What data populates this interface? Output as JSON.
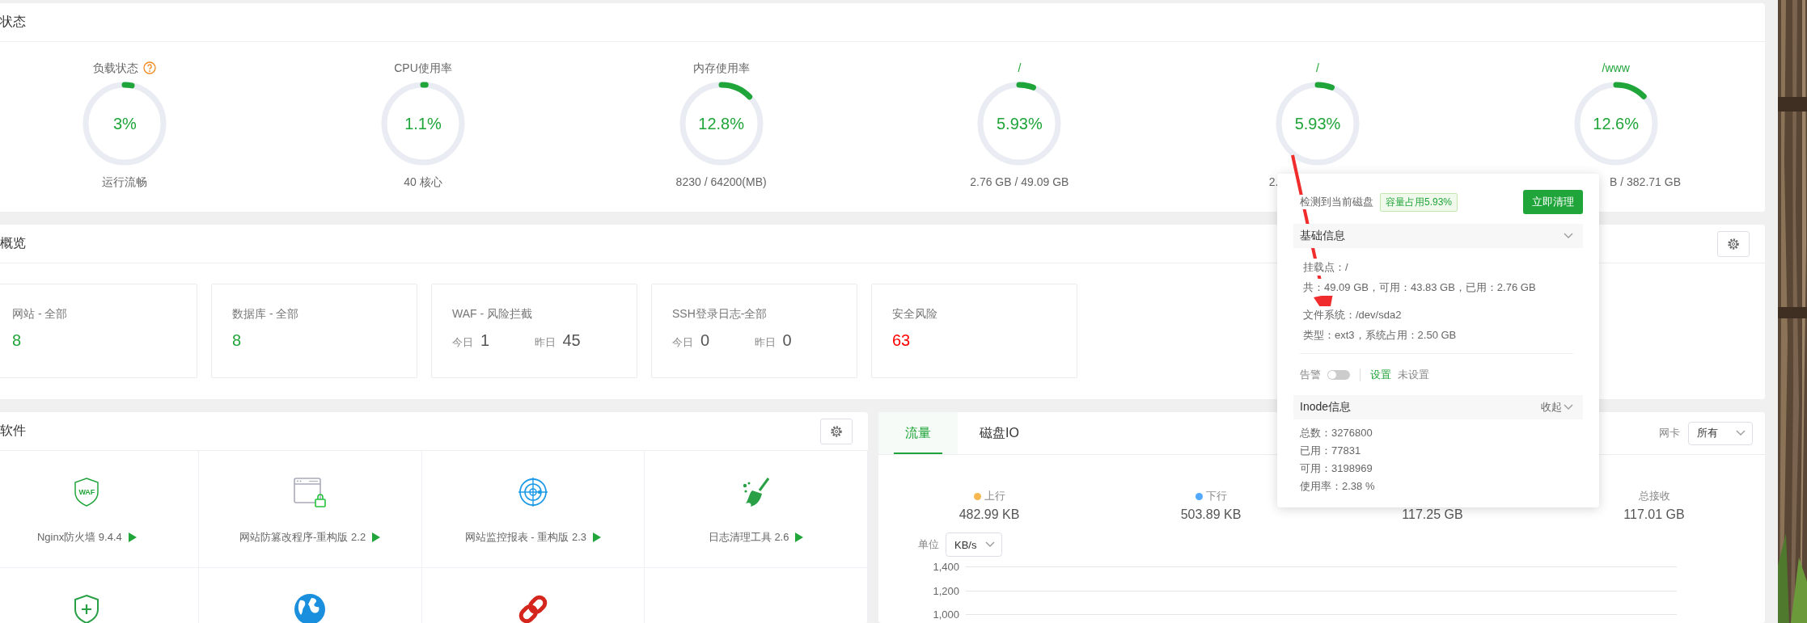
{
  "status_panel": {
    "title": "状态",
    "gauges": [
      {
        "kind": "load",
        "label": "负载状态",
        "value": "3%",
        "level": 0.03,
        "caption": "运行流畅"
      },
      {
        "kind": "cpu",
        "label": "CPU使用率",
        "value": "1.1%",
        "level": 0.011,
        "caption": "40 核心"
      },
      {
        "kind": "memory",
        "label": "内存使用率",
        "value": "12.8%",
        "level": 0.128,
        "caption": "8230 / 64200(MB)"
      },
      {
        "kind": "disk",
        "label": "/",
        "value": "5.93%",
        "level": 0.0593,
        "caption": "2.76 GB / 49.09 GB"
      },
      {
        "kind": "disk",
        "label": "/",
        "value": "5.93%",
        "level": 0.0593,
        "caption": "2."
      },
      {
        "kind": "disk",
        "label": "/www",
        "value": "12.6%",
        "level": 0.126,
        "caption": "B / 382.71 GB"
      }
    ]
  },
  "overview": {
    "title": "概览",
    "cards": [
      {
        "kind": "count",
        "label": "网站 - 全部",
        "value": "8",
        "color": "#20a53a"
      },
      {
        "kind": "count",
        "label": "数据库 - 全部",
        "value": "8",
        "color": "#20a53a"
      },
      {
        "kind": "pair",
        "label": "WAF - 风险拦截",
        "today_label": "今日",
        "today": "1",
        "yesterday_label": "昨日",
        "yesterday": "45"
      },
      {
        "kind": "pair",
        "label": "SSH登录日志-全部",
        "today_label": "今日",
        "today": "0",
        "yesterday_label": "昨日",
        "yesterday": "0"
      },
      {
        "kind": "count",
        "label": "安全风险",
        "value": "63",
        "color": "#ff0000"
      }
    ]
  },
  "software": {
    "title": "软件",
    "items": [
      {
        "kind": "waf",
        "icon_text": "WAF",
        "name": "Nginx防火墙 9.4.4"
      },
      {
        "kind": "tamper",
        "name": "网站防篡改程序-重构版 2.2"
      },
      {
        "kind": "radar",
        "name": "网站监控报表 - 重构版 2.3"
      },
      {
        "kind": "broom",
        "name": "日志清理工具 2.6"
      },
      {
        "kind": "shield"
      },
      {
        "kind": "globe"
      },
      {
        "kind": "link"
      }
    ]
  },
  "traffic": {
    "tabs": [
      {
        "label": "流量",
        "selected": true
      },
      {
        "label": "磁盘IO",
        "selected": false
      }
    ],
    "nic_label": "网卡",
    "nic_value": "所有",
    "stats": [
      {
        "label": "上行",
        "color": "#f7b851",
        "value": "482.99 KB"
      },
      {
        "label": "下行",
        "color": "#52a9ff",
        "value": "503.89 KB"
      },
      {
        "value": "117.25 GB"
      },
      {
        "label": "总接收",
        "value": "117.01 GB"
      }
    ],
    "unit_label": "单位",
    "unit_value": "KB/s",
    "y_ticks": [
      "1,400",
      "1,200",
      "1,000"
    ]
  },
  "disk_popup": {
    "prefix": "检测到当前磁盘",
    "usage_tag": "容量占用5.93%",
    "clean_button": "立即清理",
    "basic": {
      "title": "基础信息",
      "groups": [
        [
          "挂载点：/",
          "共：49.09 GB，可用：43.83 GB，已用：2.76 GB"
        ],
        [
          "文件系统：/dev/sda2",
          "类型：ext3，系统占用：2.50 GB"
        ]
      ]
    },
    "alert": {
      "label": "告警",
      "on": false,
      "link": "设置",
      "status": "未设置"
    },
    "inode": {
      "title": "Inode信息",
      "toggle": "收起",
      "lines": [
        "总数：3276800",
        "已用：77831",
        "可用：3198969",
        "使用率：2.38 %"
      ]
    }
  }
}
